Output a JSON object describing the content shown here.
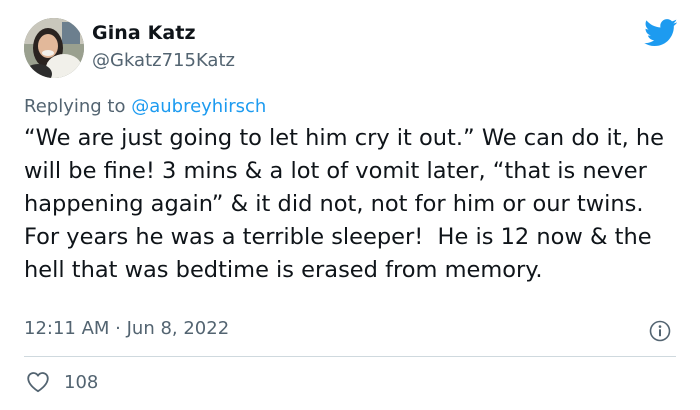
{
  "author": {
    "name": "Gina Katz",
    "handle": "@Gkatz715Katz",
    "avatar_icon": "user-avatar-photo"
  },
  "reply_context": {
    "prefix": "Replying to ",
    "mention": "@aubreyhirsch"
  },
  "tweet": {
    "text": "“We are just going to let him cry it out.” We can do it, he will be fine! 3 mins & a lot of vomit later, “that is never happening again” & it did not, not for him or our twins. For years he was a terrible sleeper!  He is 12 now & the hell that was bedtime is erased from memory.",
    "timestamp": "12:11 AM · Jun 8, 2022"
  },
  "engagement": {
    "likes": "108"
  },
  "icons": {
    "brand": "twitter-bird-icon",
    "info": "info-icon",
    "like": "heart-icon"
  },
  "colors": {
    "brand": "#1d9bf0",
    "text": "#0f1419",
    "muted": "#536471",
    "divider": "#cfd9de"
  }
}
